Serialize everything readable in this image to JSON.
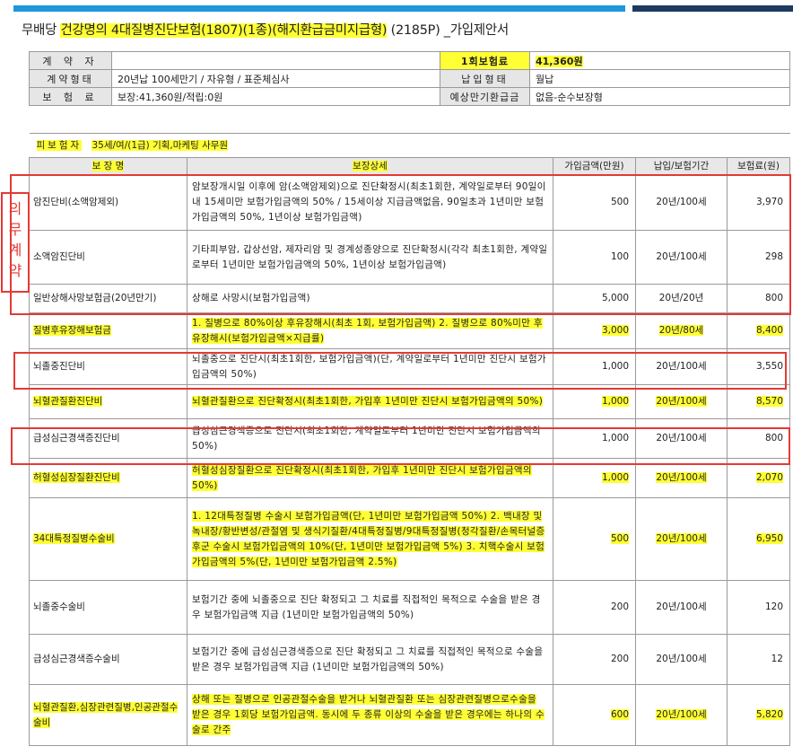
{
  "document": {
    "title_prefix": "무배당",
    "title_highlight": "건강명의 4대질병진단보험(1807)(1종)(해지환급금미지급형)",
    "title_suffix": "(2185P) _가입제안서"
  },
  "contract": {
    "contractor_label": "계 약 자",
    "contractor_value": "",
    "premium_label": "1회보험료",
    "premium_value": "41,360원",
    "type_label": "계약형태",
    "type_value": "20년납 100세만기 / 자유형 / 표준체심사",
    "payment_label": "납입형태",
    "payment_value": "월납",
    "premium_detail_label": "보 험 료",
    "premium_detail_value": "보장:41,360원/적립:0원",
    "refund_label": "예상만기환급금",
    "refund_value": "없음-순수보장형"
  },
  "insured": {
    "label": "피보험자",
    "value": "35세/여/(1급) 기획,마케팅 사무원"
  },
  "columns": [
    "보 장 명",
    "보장상세",
    "가입금액(만원)",
    "납입/보험기간",
    "보험료(원)"
  ],
  "mandatory_label": [
    "의",
    "무",
    "계",
    "약"
  ],
  "colors": {
    "highlight": "#ffff33",
    "accent_red": "#e53935",
    "bar_blue": "#1e97dd",
    "bar_navy": "#1d3a60"
  },
  "rows": [
    {
      "name": "암진단비(소액암제외)",
      "detail": "암보장개시일 이후에 암(소액암제외)으로 진단확정시(최초1회한, 계약일로부터 90일이내 15세미만 보험가입금액의 50% / 15세이상 지급금액없음, 90일초과 1년미만 보험가입금액의 50%, 1년이상 보험가입금액)",
      "amount": "500",
      "period": "20년/100세",
      "premium": "3,970"
    },
    {
      "name": "소액암진단비",
      "detail": "기타피부암, 갑상선암, 제자리암 및 경계성종양으로 진단확정시(각각 최초1회한, 계약일로부터 1년미만 보험가입금액의 50%, 1년이상 보험가입금액)",
      "amount": "100",
      "period": "20년/100세",
      "premium": "298"
    },
    {
      "name": "일반상해사망보험금(20년만기)",
      "detail": "상해로 사망시(보험가입금액)",
      "amount": "5,000",
      "period": "20년/20년",
      "premium": "800"
    },
    {
      "name": "질병후유장해보험금",
      "detail": "1. 질병으로 80%이상 후유장해시(최초 1회, 보험가입금액) 2. 질병으로 80%미만 후유장해시(보험가입금액×지급률)",
      "amount": "3,000",
      "period": "20년/80세",
      "premium": "8,400"
    },
    {
      "name": "뇌졸중진단비",
      "detail": "뇌졸중으로 진단시(최초1회한, 보험가입금액)(단, 계약일로부터 1년미만 진단시 보험가입금액의 50%)",
      "amount": "1,000",
      "period": "20년/100세",
      "premium": "3,550"
    },
    {
      "name": "뇌혈관질환진단비",
      "detail": "뇌혈관질환으로 진단확정시(최초1회한, 가입후 1년미만 진단시 보험가입금액의 50%)",
      "amount": "1,000",
      "period": "20년/100세",
      "premium": "8,570"
    },
    {
      "name": "급성심근경색증진단비",
      "detail": "급성심근경색증으로 진단시(최초1회한, 계약일로부터 1년미만 진단시 보험가입금액의 50%)",
      "amount": "1,000",
      "period": "20년/100세",
      "premium": "800"
    },
    {
      "name": "허혈성심장질환진단비",
      "detail": "허혈성심장질환으로 진단확정시(최초1회한, 가입후 1년미만 진단시 보험가입금액의 50%)",
      "amount": "1,000",
      "period": "20년/100세",
      "premium": "2,070"
    },
    {
      "name": "34대특정질병수술비",
      "detail": "1. 12대특정질병 수술시 보험가입금액(단, 1년미만 보험가입금액 50%) 2. 백내장 및 녹내장/황반변성/관절염 및 생식기질환/4대특정질병/9대특정질병(청각질환/손목터널증후군 수술시 보험가입금액의 10%(단, 1년미만 보험가입금액 5%) 3. 치핵수술시 보험가입금액의 5%(단, 1년미만 보험가입금액 2.5%)",
      "amount": "500",
      "period": "20년/100세",
      "premium": "6,950"
    },
    {
      "name": "뇌졸중수술비",
      "detail": "보험기간 중에 뇌졸중으로 진단 확정되고 그 치료를 직접적인 목적으로 수술을 받은 경우 보험가입금액 지급 (1년미만 보험가입금액의 50%)",
      "amount": "200",
      "period": "20년/100세",
      "premium": "120"
    },
    {
      "name": "급성심근경색증수술비",
      "detail": "보험기간 중에 급성심근경색증으로 진단 확정되고 그 치료를 직접적인 목적으로 수술을 받은 경우 보험가입금액 지급 (1년미만 보험가입금액의 50%)",
      "amount": "200",
      "period": "20년/100세",
      "premium": "12"
    },
    {
      "name": "뇌혈관질환,심장관련질병,인공관절수술비",
      "detail": "상해 또는 질병으로 인공관절수술을 받거나 뇌혈관질환 또는 심장관련질병으로수술을 받은 경우 1회당 보험가입금액. 동시에 두 종류 이상의 수술을 받은 경우에는 하나의 수술로 간주",
      "amount": "600",
      "period": "20년/100세",
      "premium": "5,820"
    }
  ]
}
